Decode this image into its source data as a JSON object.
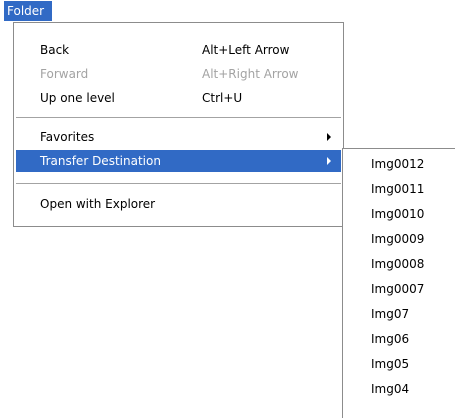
{
  "menubar": {
    "folder_label": "Folder"
  },
  "menu": {
    "back": {
      "label": "Back",
      "shortcut": "Alt+Left Arrow"
    },
    "forward": {
      "label": "Forward",
      "shortcut": "Alt+Right Arrow"
    },
    "up": {
      "label": "Up one level",
      "shortcut": "Ctrl+U"
    },
    "favorites": {
      "label": "Favorites"
    },
    "transfer": {
      "label": "Transfer Destination"
    },
    "explorer": {
      "label": "Open with Explorer"
    }
  },
  "submenu": {
    "items": [
      "Img0012",
      "Img0011",
      "Img0010",
      "Img0009",
      "Img0008",
      "Img0007",
      "Img07",
      "Img06",
      "Img05",
      "Img04"
    ]
  },
  "colors": {
    "highlight": "#316ac5",
    "disabled_text": "#a3a3a3"
  }
}
